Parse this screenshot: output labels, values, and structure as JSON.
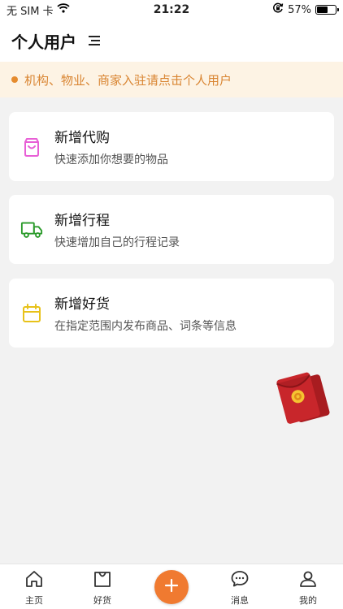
{
  "status_bar": {
    "carrier": "无 SIM 卡",
    "time": "21:22",
    "battery_percent": "57%",
    "battery_level": 0.57
  },
  "header": {
    "title": "个人用户"
  },
  "notice": {
    "text": "机构、物业、商家入驻请点击个人用户"
  },
  "cards": [
    {
      "title": "新增代购",
      "subtitle": "快速添加你想要的物品",
      "icon": "shopping-bag-icon",
      "color": "#e85fd6"
    },
    {
      "title": "新增行程",
      "subtitle": "快速增加自己的行程记录",
      "icon": "truck-icon",
      "color": "#2a9a2a"
    },
    {
      "title": "新增好货",
      "subtitle": "在指定范围内发布商品、词条等信息",
      "icon": "calendar-icon",
      "color": "#e8c21a"
    }
  ],
  "tabbar": {
    "items": [
      {
        "label": "主页",
        "icon": "home-icon"
      },
      {
        "label": "好货",
        "icon": "bag-icon"
      },
      {
        "label": "消息",
        "icon": "chat-icon"
      },
      {
        "label": "我的",
        "icon": "user-icon"
      }
    ],
    "fab_icon": "plus-icon",
    "fab_color": "#f07a30"
  },
  "colors": {
    "accent": "#f07a30",
    "notice_bg": "#fdf3e4",
    "notice_text": "#d98532",
    "envelope": "#c8262b"
  }
}
